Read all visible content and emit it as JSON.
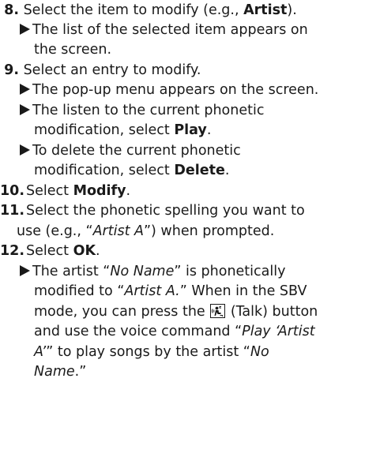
{
  "steps": {
    "s8": {
      "num": "8.",
      "pre": "Select the item to modify (e.g., ",
      "bold": "Artist",
      "post": ").",
      "bullets": {
        "b1": {
          "l1": "The list of the selected item appears on",
          "l2": "the screen."
        }
      }
    },
    "s9": {
      "num": "9.",
      "text": "Select an entry to modify.",
      "bullets": {
        "b1": {
          "l1": "The pop-up menu appears on the screen."
        },
        "b2": {
          "l1": "The listen to the current phonetic",
          "l2pre": "modification, select ",
          "l2bold": "Play",
          "l2post": "."
        },
        "b3": {
          "l1": "To delete the current phonetic",
          "l2pre": "modification, select ",
          "l2bold": "Delete",
          "l2post": "."
        }
      }
    },
    "s10": {
      "num": "10.",
      "pre": "Select ",
      "bold": "Modify",
      "post": "."
    },
    "s11": {
      "num": "11.",
      "l1": "Select the phonetic spelling you want to",
      "l2pre": "use (e.g., “",
      "l2ital": "Artist A",
      "l2post": "”) when prompted."
    },
    "s12": {
      "num": "12.",
      "pre": "Select ",
      "bold": "OK",
      "post": ".",
      "bullet": {
        "l1pre": "The artist “",
        "l1ital": "No Name",
        "l1post": "” is phonetically",
        "l2pre": "modified to “",
        "l2ital": "Artist A.",
        "l2post": "” When in the SBV",
        "l3pre": "mode, you can press the ",
        "l3post": " (Talk) button",
        "l4pre": "and use the voice command “",
        "l4ital": "Play ‘Artist",
        "l5ital": "A’",
        "l5mid": "” to play songs by the artist “",
        "l5ital2": "No",
        "l6ital": "Name",
        "l6post": ".”"
      }
    }
  },
  "icons": {
    "talk": "talk-button-icon"
  },
  "colors": {
    "text": "#1a1a1a",
    "background": "#ffffff"
  }
}
